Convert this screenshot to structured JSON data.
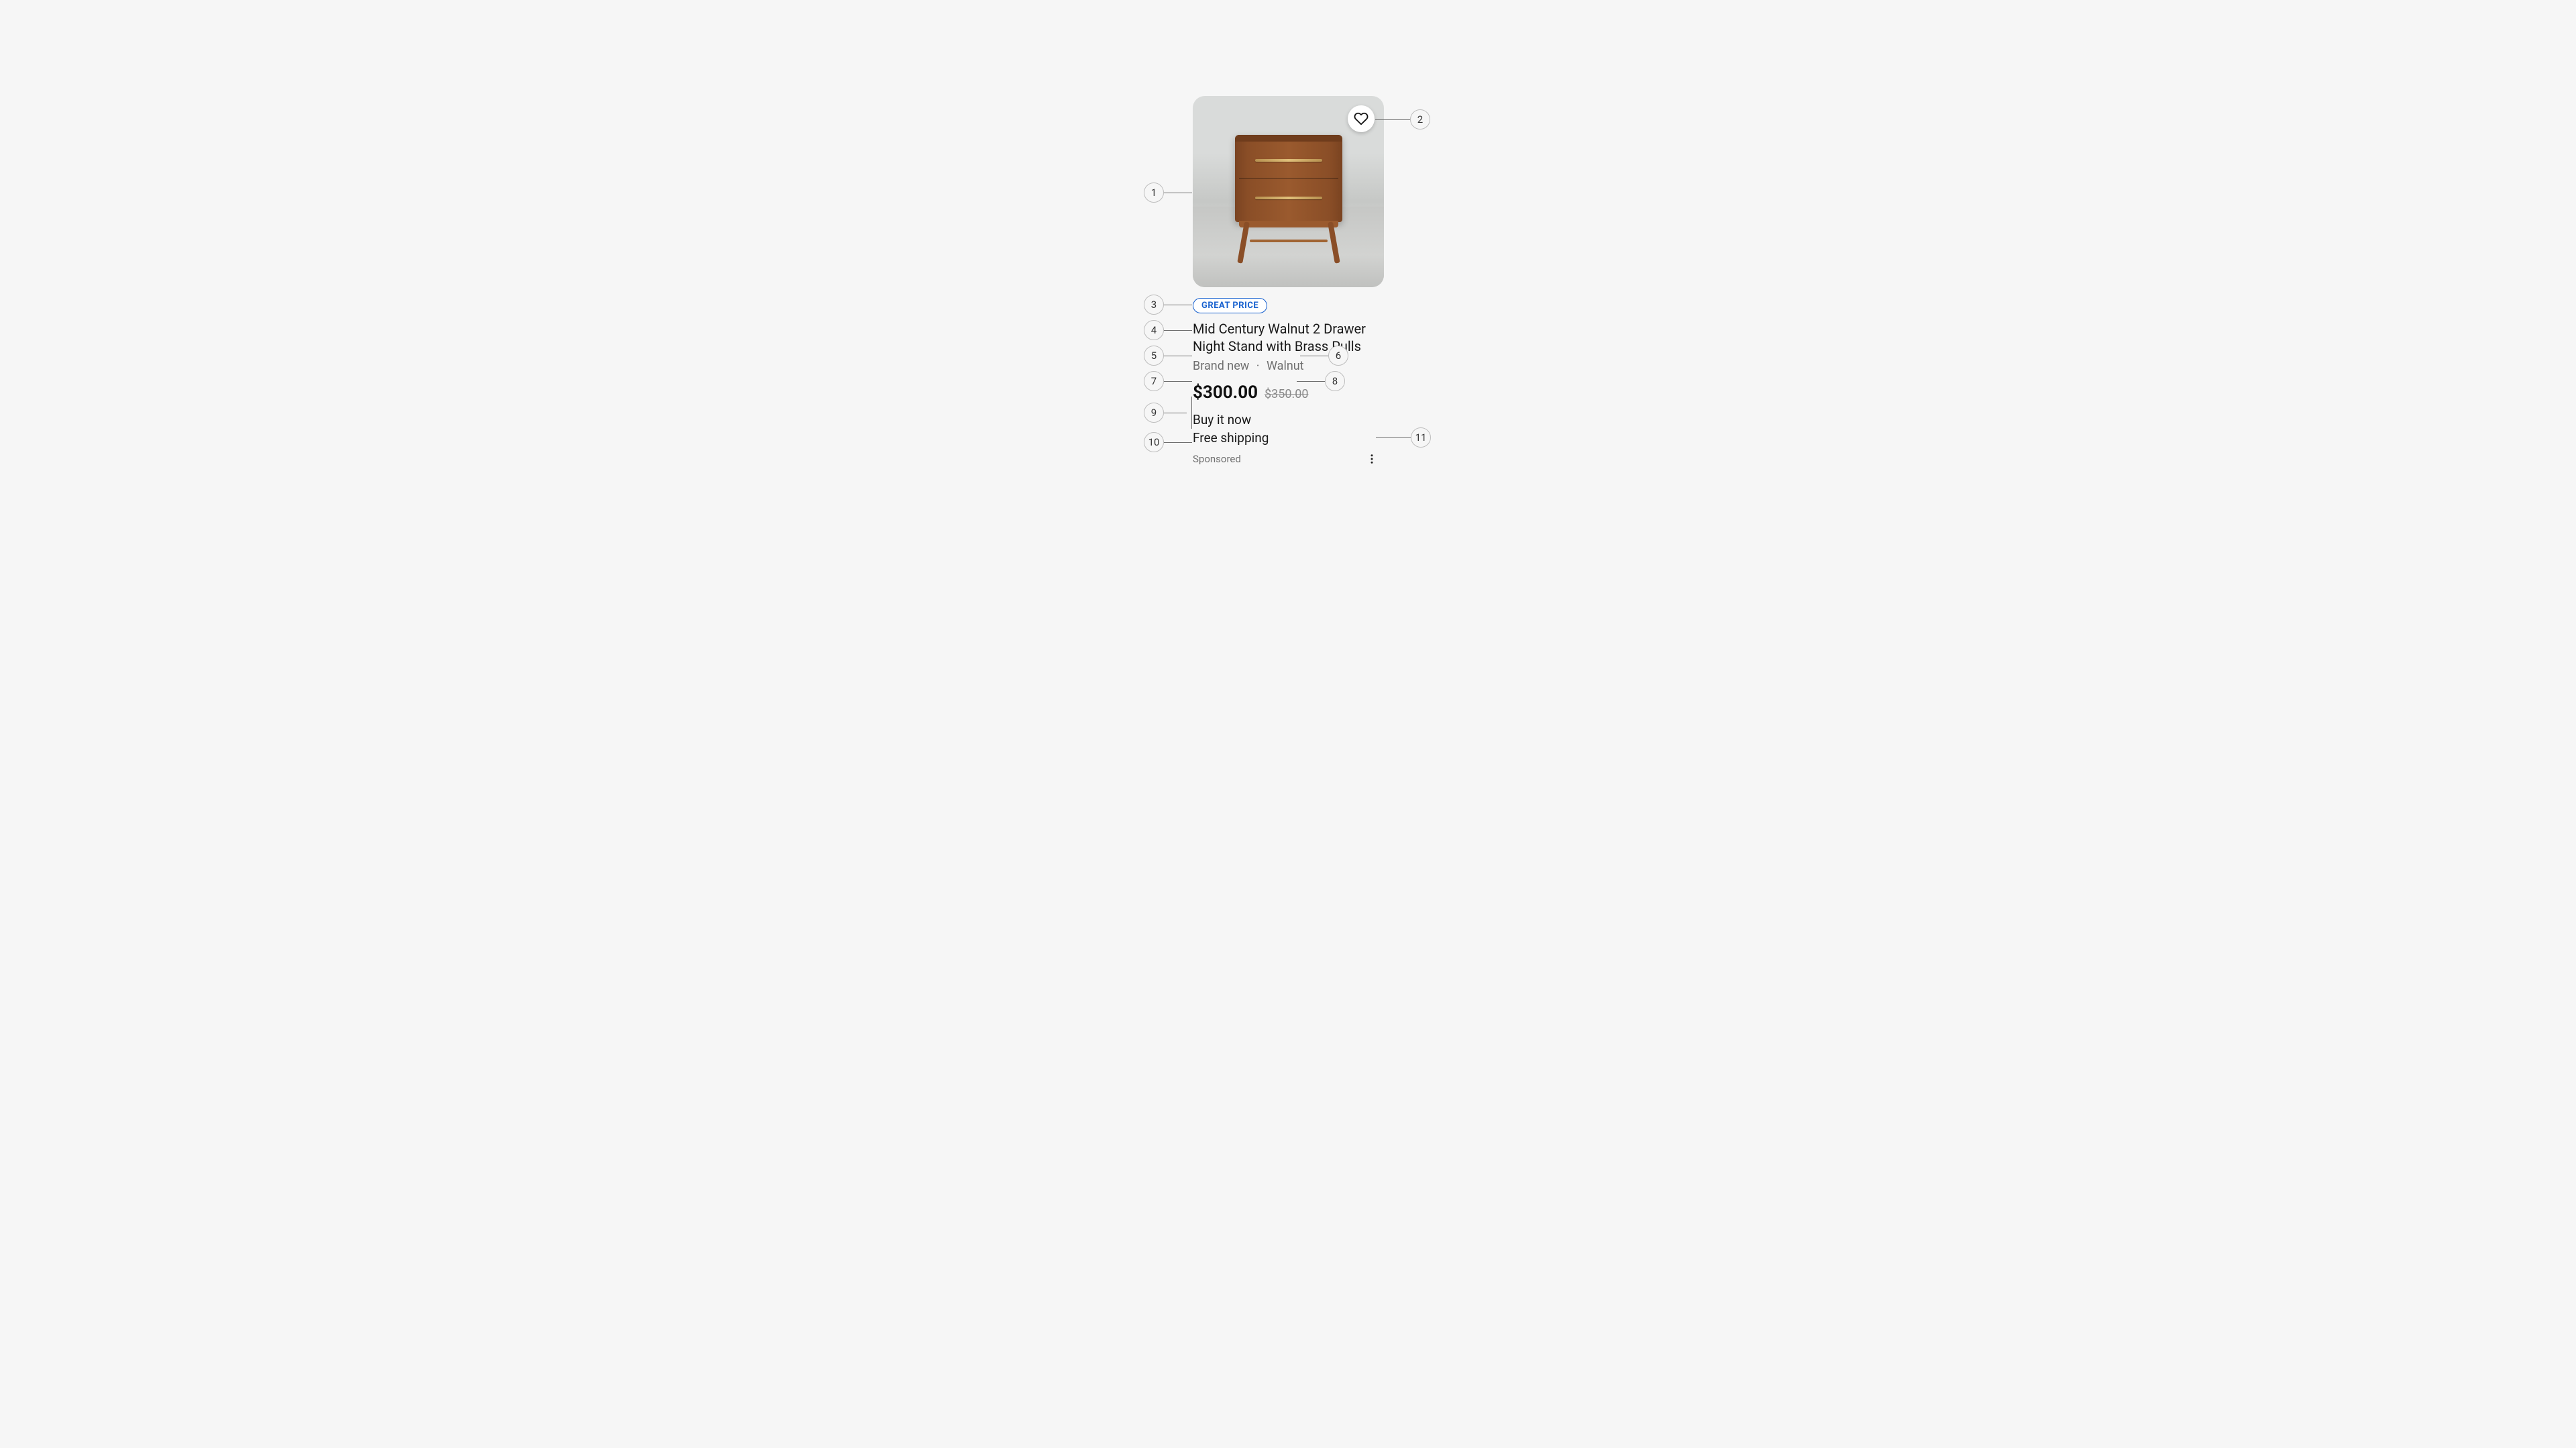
{
  "product": {
    "badge": "GREAT PRICE",
    "title_line1": "Mid Century Walnut 2 Drawer",
    "title_line2": "Night Stand with Brass Pulls",
    "condition": "Brand new",
    "aspect": "Walnut",
    "dot": "·",
    "price": "$300.00",
    "original_price": "$350.00",
    "purchase_option": "Buy it now",
    "shipping": "Free shipping",
    "sponsored": "Sponsored"
  },
  "annotations": {
    "n1": "1",
    "n2": "2",
    "n3": "3",
    "n4": "4",
    "n5": "5",
    "n6": "6",
    "n7": "7",
    "n8": "8",
    "n9": "9",
    "n10": "10",
    "n11": "11"
  }
}
